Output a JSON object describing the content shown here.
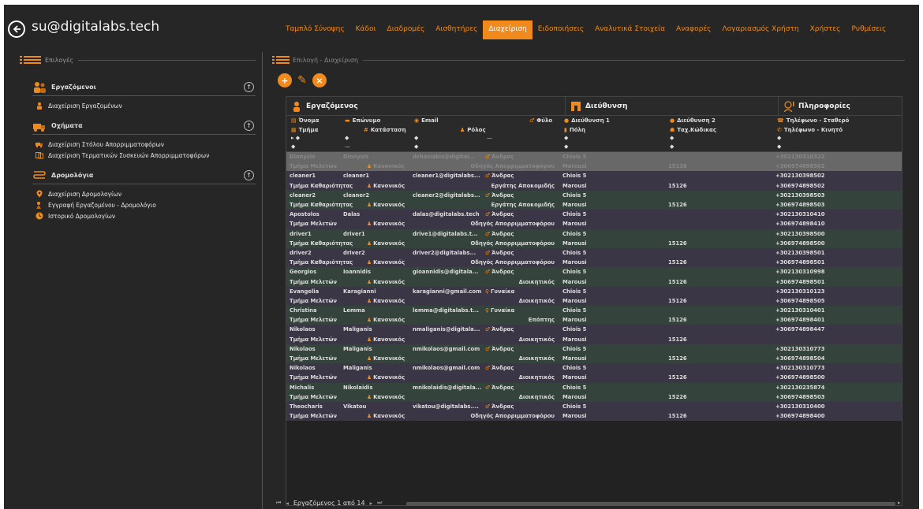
{
  "header": {
    "user": "su@digitalabs.tech",
    "tabs": [
      {
        "label": "Ταμπλό Σύνοψης",
        "active": false
      },
      {
        "label": "Κάδοι",
        "active": false
      },
      {
        "label": "Διαδρομές",
        "active": false
      },
      {
        "label": "Αισθητήρες",
        "active": false
      },
      {
        "label": "Διαχείριση",
        "active": true
      },
      {
        "label": "Ειδοποιήσεις",
        "active": false
      },
      {
        "label": "Αναλυτικά Στοιχεία",
        "active": false
      },
      {
        "label": "Αναφορές",
        "active": false
      },
      {
        "label": "Λογαριασμός Χρήστη",
        "active": false
      },
      {
        "label": "Χρήστες",
        "active": false
      },
      {
        "label": "Ρυθμίσεις",
        "active": false
      }
    ]
  },
  "left": {
    "title": "Επιλογές",
    "sections": [
      {
        "title": "Εργαζόμενοι",
        "collapse": "↑",
        "items": [
          "Διαχείριση Εργαζομένων"
        ]
      },
      {
        "title": "Οχήματα",
        "collapse": "↑",
        "items": [
          "Διαχείριση Στόλου Απορριμματοφόρων",
          "Διαχείριση Τερματικών Συσκευών Απορριμματοφόρων"
        ]
      },
      {
        "title": "Δρομολόγια",
        "collapse": "↑",
        "items": [
          "Διαχείριση Δρομολογίων",
          "Εγγραφή Εργαζομένου - Δρομολόγιο",
          "Ιστορικό Δρομολογίων"
        ]
      }
    ]
  },
  "right": {
    "title": "Επιλογή - Διαχείριση",
    "toolbar": {
      "add": "+",
      "edit": "✎",
      "delete": "×"
    },
    "bands": [
      "Εργαζόμενος",
      "Διεύθυνση",
      "Πληροφορίες"
    ],
    "columns_row1": [
      "Όνομα",
      "Επώνυμο",
      "Email",
      "Φύλο",
      "Διεύθυνση 1",
      "Διεύθυνση 2",
      "Τηλέφωνο - Σταθερό"
    ],
    "columns_row2": [
      "Τμήμα",
      "Κατάσταση",
      "Ρόλος",
      "Πόλη",
      "Ταχ.Κώδικας",
      "Τηλέφωνο - Κινητό"
    ],
    "rows": [
      {
        "name": "Dionysis",
        "surname": "Dionysis",
        "email": "dchasiakis@digital...",
        "gender": "Άνδρας",
        "addr1": "Chiois 5",
        "addr2": "",
        "phone": "+302130310322",
        "dept": "Τμήμα Μελετών",
        "status": "Κανονικός",
        "role": "Οδηγός Απορριμματοφόρου",
        "city": "Marousi",
        "zip": "15126",
        "mobile": "+306974898502",
        "style": "sel"
      },
      {
        "name": "cleaner1",
        "surname": "cleaner1",
        "email": "cleaner1@digitalabs...",
        "gender": "Άνδρας",
        "addr1": "Chiois 5",
        "addr2": "",
        "phone": "+302130398502",
        "dept": "Τμήμα Καθαριότητας",
        "status": "Κανονικός",
        "role": "Εργάτης Αποκομιδής",
        "city": "Marousi",
        "zip": "15126",
        "mobile": "+306974898502",
        "style": "dk"
      },
      {
        "name": "cleaner2",
        "surname": "cleaner2",
        "email": "cleaner2@digitalabs...",
        "gender": "Άνδρας",
        "addr1": "Chiois 5",
        "addr2": "",
        "phone": "+302130398503",
        "dept": "Τμήμα Καθαριότητας",
        "status": "Κανονικός",
        "role": "Εργάτης Αποκομιδής",
        "city": "Marousi",
        "zip": "15126",
        "mobile": "+306974898503",
        "style": "gr"
      },
      {
        "name": "Apostolos",
        "surname": "Dalas",
        "email": "dalas@digitalabs.tech",
        "gender": "Άνδρας",
        "addr1": "Chiois 5",
        "addr2": "",
        "phone": "+302130310410",
        "dept": "Τμήμα Μελετών",
        "status": "Κανονικός",
        "role": "Οδηγός Απορριμματοφόρου",
        "city": "Marousi",
        "zip": "",
        "mobile": "+306974898410",
        "style": "dk"
      },
      {
        "name": "driver1",
        "surname": "driver1",
        "email": "drive1@digitalabs.t...",
        "gender": "Άνδρας",
        "addr1": "Chiois 5",
        "addr2": "",
        "phone": "+302130398500",
        "dept": "Τμήμα Καθαριότητας",
        "status": "Κανονικός",
        "role": "Οδηγός Απορριμματοφόρου",
        "city": "Marousi",
        "zip": "15126",
        "mobile": "+306974898500",
        "style": "gr"
      },
      {
        "name": "driver2",
        "surname": "driver2",
        "email": "driver2@digitalabs...",
        "gender": "Άνδρας",
        "addr1": "Chiois 5",
        "addr2": "",
        "phone": "+302130398501",
        "dept": "Τμήμα Καθαριότητας",
        "status": "Κανονικός",
        "role": "Οδηγός Απορριμματοφόρου",
        "city": "Marousi",
        "zip": "15126",
        "mobile": "+306974898501",
        "style": "dk"
      },
      {
        "name": "Georgios",
        "surname": "Ioannidis",
        "email": "gioannidis@digitala...",
        "gender": "Άνδρας",
        "addr1": "Chiois 5",
        "addr2": "",
        "phone": "+302130310998",
        "dept": "Τμήμα Μελετών",
        "status": "Κανονικός",
        "role": "Διοικητικός",
        "city": "Marousi",
        "zip": "15126",
        "mobile": "+306974898501",
        "style": "gr"
      },
      {
        "name": "Evangelia",
        "surname": "Karagianni",
        "email": "karagianni@gmail.com",
        "gender": "Γυναίκα",
        "addr1": "Chiois 5",
        "addr2": "",
        "phone": "+302130310123",
        "dept": "Τμήμα Μελετών",
        "status": "Κανονικός",
        "role": "Διοικητικός",
        "city": "Marousi",
        "zip": "15126",
        "mobile": "+306974898505",
        "style": "dk"
      },
      {
        "name": "Christina",
        "surname": "Lemma",
        "email": "lemma@digitalabs.t...",
        "gender": "Γυναίκα",
        "addr1": "Chiois 5",
        "addr2": "",
        "phone": "+302130310401",
        "dept": "Τμήμα Μελετών",
        "status": "Κανονικός",
        "role": "Επόπτης",
        "city": "Marousi",
        "zip": "15126",
        "mobile": "+306974898401",
        "style": "gr"
      },
      {
        "name": "Nikolaos",
        "surname": "Maliganis",
        "email": "nmaliganis@digitala...",
        "gender": "Άνδρας",
        "addr1": "Chiois 5",
        "addr2": "",
        "phone": "+306974898447",
        "dept": "Τμήμα Μελετών",
        "status": "Κανονικός",
        "role": "Διοικητικός",
        "city": "Marousi",
        "zip": "15126",
        "mobile": "",
        "style": "dk"
      },
      {
        "name": "Nikolaos",
        "surname": "Maliganis",
        "email": "nmikolaos@gmail.com",
        "gender": "Άνδρας",
        "addr1": "Chiois 5",
        "addr2": "",
        "phone": "+302130310773",
        "dept": "Τμήμα Μελετών",
        "status": "Κανονικός",
        "role": "Διοικητικός",
        "city": "Marousi",
        "zip": "15126",
        "mobile": "+306974898504",
        "style": "gr"
      },
      {
        "name": "Nikolaos",
        "surname": "Maliganis",
        "email": "nmikolaos@gmail.com",
        "gender": "Άνδρας",
        "addr1": "Chiois 5",
        "addr2": "",
        "phone": "+302130310773",
        "dept": "Τμήμα Μελετών",
        "status": "Κανονικός",
        "role": "Διοικητικός",
        "city": "Marousi",
        "zip": "15126",
        "mobile": "+306974898500",
        "style": "dk"
      },
      {
        "name": "Michalis",
        "surname": "Nikolaidis",
        "email": "mnikolaidis@digitala...",
        "gender": "Άνδρας",
        "addr1": "Chiois 5",
        "addr2": "",
        "phone": "+302130235874",
        "dept": "Τμήμα Μελετών",
        "status": "Κανονικός",
        "role": "Διοικητικός",
        "city": "Marousi",
        "zip": "15226",
        "mobile": "+306974898503",
        "style": "gr"
      },
      {
        "name": "Theocharis",
        "surname": "Vikatou",
        "email": "vikatou@digitalabs....",
        "gender": "Άνδρας",
        "addr1": "Chiois 5",
        "addr2": "",
        "phone": "+302130310400",
        "dept": "Τμήμα Μελετών",
        "status": "Κανονικός",
        "role": "Οδηγός Απορριμματοφόρου",
        "city": "Marousi",
        "zip": "15126",
        "mobile": "+306974898400",
        "style": "dk"
      }
    ],
    "pager": {
      "text": "Εργαζόμενος 1 από 14"
    }
  },
  "colors": {
    "accent": "#f08a1c",
    "bg": "#262626",
    "row_dark": "#3b3646",
    "row_green": "#34433b"
  }
}
